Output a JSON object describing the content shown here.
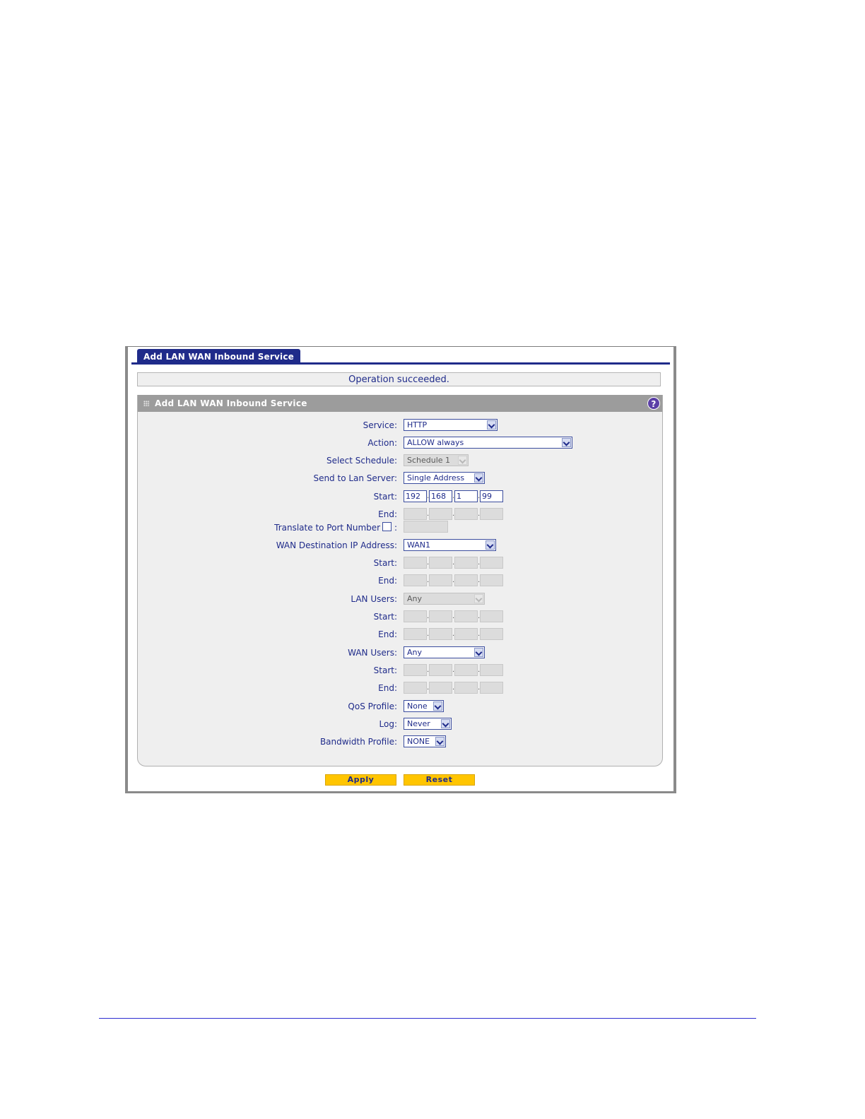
{
  "window": {
    "tab_title": "Add LAN WAN Inbound Service"
  },
  "status": {
    "message": "Operation succeeded."
  },
  "panel": {
    "title": "Add LAN WAN Inbound Service",
    "help_icon": "?"
  },
  "form": {
    "service": {
      "label": "Service:",
      "value": "HTTP"
    },
    "action": {
      "label": "Action:",
      "value": "ALLOW always"
    },
    "schedule": {
      "label": "Select Schedule:",
      "value": "Schedule 1"
    },
    "send_to_lan_server": {
      "label": "Send to Lan Server:",
      "value": "Single Address"
    },
    "lan_server_start": {
      "label": "Start:",
      "octets": [
        "192",
        "168",
        "1",
        "99"
      ]
    },
    "lan_server_end": {
      "label": "End:",
      "octets": [
        "",
        "",
        "",
        ""
      ]
    },
    "translate_port": {
      "label": "Translate to Port Number",
      "colon": ":",
      "checked": false,
      "value": ""
    },
    "wan_destination": {
      "label": "WAN Destination IP Address:",
      "value": "WAN1"
    },
    "wan_dest_start": {
      "label": "Start:",
      "octets": [
        "",
        "",
        "",
        ""
      ]
    },
    "wan_dest_end": {
      "label": "End:",
      "octets": [
        "",
        "",
        "",
        ""
      ]
    },
    "lan_users": {
      "label": "LAN Users:",
      "value": "Any"
    },
    "lan_users_start": {
      "label": "Start:",
      "octets": [
        "",
        "",
        "",
        ""
      ]
    },
    "lan_users_end": {
      "label": "End:",
      "octets": [
        "",
        "",
        "",
        ""
      ]
    },
    "wan_users": {
      "label": "WAN Users:",
      "value": "Any"
    },
    "wan_users_start": {
      "label": "Start:",
      "octets": [
        "",
        "",
        "",
        ""
      ]
    },
    "wan_users_end": {
      "label": "End:",
      "octets": [
        "",
        "",
        "",
        ""
      ]
    },
    "qos_profile": {
      "label": "QoS Profile:",
      "value": "None"
    },
    "log": {
      "label": "Log:",
      "value": "Never"
    },
    "bandwidth_profile": {
      "label": "Bandwidth Profile:",
      "value": "NONE"
    }
  },
  "buttons": {
    "apply": "Apply",
    "reset": "Reset"
  }
}
